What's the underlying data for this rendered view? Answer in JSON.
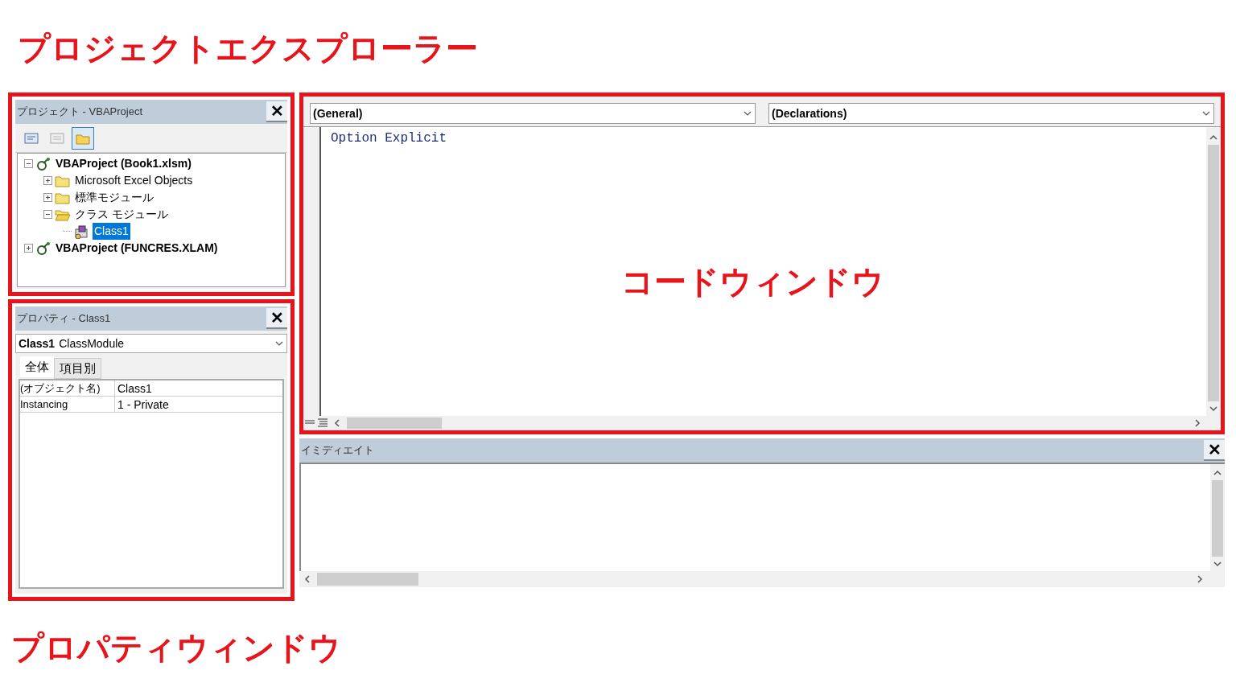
{
  "annotations": {
    "project_explorer": "プロジェクトエクスプローラー",
    "code_window": "コードウィンドウ",
    "properties_window": "プロパティウィンドウ"
  },
  "project_panel": {
    "title": "プロジェクト - VBAProject",
    "close": "✕",
    "toolbar": [
      {
        "kind": "view-code",
        "selected": false
      },
      {
        "kind": "view-object",
        "selected": false
      },
      {
        "kind": "toggle-folders",
        "selected": true
      }
    ],
    "tree": [
      {
        "label": "VBAProject (Book1.xlsm)",
        "kind": "project",
        "expanded": true,
        "selected": false,
        "children": [
          {
            "label": "Microsoft Excel Objects",
            "kind": "folder",
            "expanded": false,
            "selected": false
          },
          {
            "label": "標準モジュール",
            "kind": "folder",
            "expanded": false,
            "selected": false
          },
          {
            "label": "クラス モジュール",
            "kind": "folder",
            "expanded": true,
            "selected": false,
            "children": [
              {
                "label": "Class1",
                "kind": "class",
                "selected": true
              }
            ]
          }
        ]
      },
      {
        "label": "VBAProject (FUNCRES.XLAM)",
        "kind": "project",
        "expanded": false,
        "selected": false
      }
    ]
  },
  "properties_panel": {
    "title": "プロパティ - Class1",
    "close": "✕",
    "object_name": "Class1",
    "object_type": "ClassModule",
    "tabs": [
      {
        "label": "全体",
        "selected": true
      },
      {
        "label": "項目別",
        "selected": false
      }
    ],
    "rows": [
      {
        "name": "(オブジェクト名)",
        "value": "Class1"
      },
      {
        "name": "Instancing",
        "value": "1 - Private"
      }
    ]
  },
  "code_window": {
    "object_dropdown": "(General)",
    "procedure_dropdown": "(Declarations)",
    "lines": [
      "Option Explicit"
    ]
  },
  "immediate_window": {
    "title": "イミディエイト",
    "close": "✕"
  }
}
